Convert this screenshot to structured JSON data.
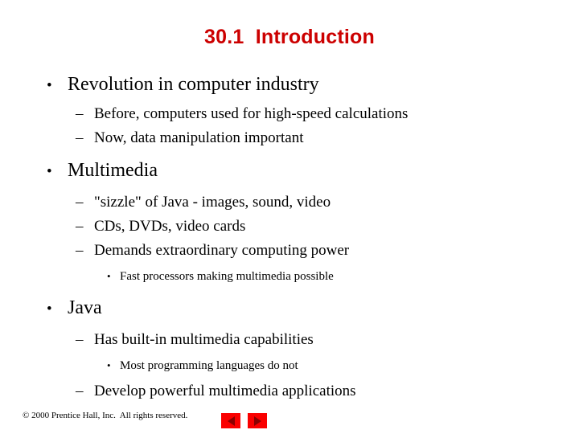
{
  "slide": {
    "title": "30.1  Introduction",
    "title_color": "#cc0000",
    "background_color": "#ffffff",
    "text_color": "#000000"
  },
  "bullets": {
    "b1": {
      "mark": "•",
      "text": "Revolution in computer industry"
    },
    "b1s1": {
      "mark": "–",
      "text": "Before, computers used for high-speed calculations"
    },
    "b1s2": {
      "mark": "–",
      "text": "Now, data manipulation important"
    },
    "b2": {
      "mark": "•",
      "text": "Multimedia"
    },
    "b2s1": {
      "mark": "–",
      "text": "\"sizzle\" of Java - images, sound, video"
    },
    "b2s2": {
      "mark": "–",
      "text": "CDs, DVDs, video cards"
    },
    "b2s3": {
      "mark": "–",
      "text": "Demands extraordinary computing power"
    },
    "b2s3a": {
      "mark": "•",
      "text": "Fast processors making multimedia possible"
    },
    "b3": {
      "mark": "•",
      "text": "Java"
    },
    "b3s1": {
      "mark": "–",
      "text": "Has built-in multimedia capabilities"
    },
    "b3s1a": {
      "mark": "•",
      "text": "Most programming languages do not"
    },
    "b3s2": {
      "mark": "–",
      "text": "Develop powerful multimedia applications"
    }
  },
  "footer": {
    "copyright": "© 2000 Prentice Hall, Inc.  All rights reserved.",
    "nav": {
      "previous_label": "◀",
      "next_label": "▶",
      "button_color": "#fa0000",
      "arrow_color": "#8a0000"
    }
  }
}
